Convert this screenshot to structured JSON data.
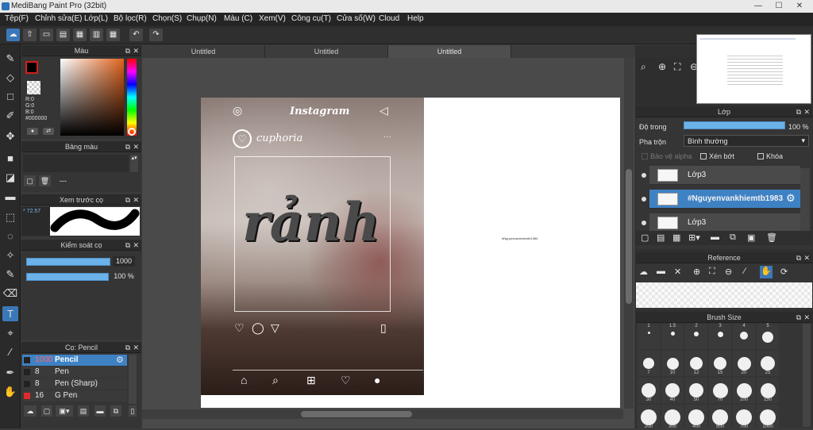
{
  "window": {
    "title": "MediBang Paint Pro (32bit)"
  },
  "menu": [
    "Tệp(F)",
    "Chỉnh sửa(E)",
    "Lớp(L)",
    "Bộ lọc(R)",
    "Chọn(S)",
    "Chụp(N)",
    "Màu (C)",
    "Xem(V)",
    "Công cụ(T)",
    "Cửa số(W)",
    "Cloud",
    "Help"
  ],
  "color_panel": {
    "title": "Màu",
    "r": "R:0",
    "g": "G:0",
    "b": "B:0",
    "hex": "#000000",
    "fg_color": "#000000"
  },
  "palette_panel": {
    "title": "Bảng màu",
    "value": "---"
  },
  "brush_preview": {
    "title": "Xem trước cọ",
    "size": "72.57"
  },
  "brush_control": {
    "title": "Kiểm soát cọ",
    "size_value": "1000",
    "opacity_value": "100 %"
  },
  "brush_list": {
    "title": "Cọ: Pencil",
    "items": [
      {
        "size": "1000",
        "name": "Pencil",
        "active": true
      },
      {
        "size": "8",
        "name": "Pen",
        "active": false
      },
      {
        "size": "8",
        "name": "Pen (Sharp)",
        "active": false
      },
      {
        "size": "16",
        "name": "G Pen",
        "active": false
      }
    ]
  },
  "doc_tabs": [
    "Untitled",
    "Untitled",
    "Untitled"
  ],
  "canvas": {
    "app_header": "Instagram",
    "username": "cuphoria",
    "big_word": "rảnh",
    "watermark": "#Nguyenvankhiemtb1983"
  },
  "layers_panel": {
    "title": "Lớp",
    "opacity_label": "Độ trong",
    "opacity_value": "100 %",
    "opacity_fraction": 1.0,
    "blend_label": "Pha trộn",
    "blend_value": "Bình thường",
    "protect_alpha": "Bảo vệ alpha",
    "clipping": "Xén bớt",
    "lock": "Khóa",
    "layers": [
      {
        "name": "Lớp3",
        "active": false
      },
      {
        "name": "#Nguyenvankhiemtb1983",
        "active": true
      },
      {
        "name": "Lớp3",
        "active": false
      }
    ]
  },
  "reference_panel": {
    "title": "Reference"
  },
  "brush_size_panel": {
    "title": "Brush Size",
    "rows": [
      [
        "1",
        "1.5",
        "2",
        "3",
        "4",
        "5"
      ],
      [
        "7",
        "10",
        "12",
        "15",
        "20",
        "25"
      ],
      [
        "30",
        "40",
        "50",
        "70",
        "100",
        "150"
      ],
      [
        "200",
        "300",
        "400",
        "500",
        "700",
        "1000"
      ]
    ]
  },
  "colors": {
    "accent": "#3b78b8",
    "menubar": "#252525",
    "panel": "#353535",
    "slider": "#6cb2ea"
  }
}
